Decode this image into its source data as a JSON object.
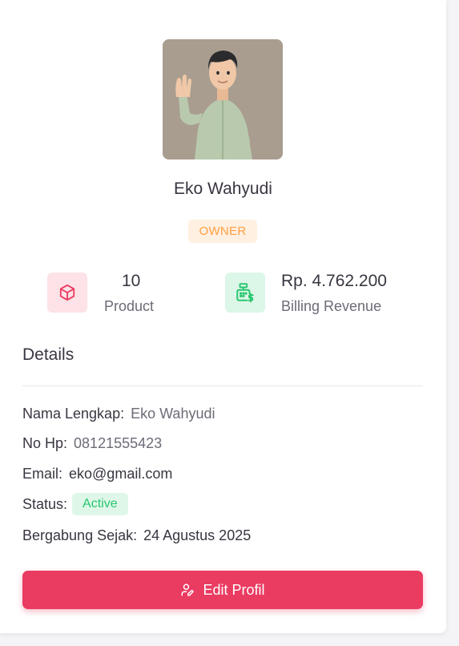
{
  "profile": {
    "name": "Eko Wahyudi",
    "role": "OWNER",
    "avatar_icon": "user-avatar-3d"
  },
  "stats": {
    "product": {
      "value": "10",
      "label": "Product",
      "icon": "cube-icon",
      "color": "#ea3b61"
    },
    "revenue": {
      "value": "Rp. 4.762.200",
      "label": "Billing Revenue",
      "icon": "cash-register-icon",
      "color": "#28c76f"
    }
  },
  "details": {
    "title": "Details",
    "full_name_label": "Nama Lengkap:",
    "full_name": "Eko Wahyudi",
    "phone_label": "No Hp:",
    "phone": "08121555423",
    "email_label": "Email:",
    "email": "eko@gmail.com",
    "status_label": "Status:",
    "status": "Active",
    "joined_label": "Bergabung Sejak:",
    "joined": "24 Agustus 2025"
  },
  "actions": {
    "edit_label": "Edit Profil",
    "edit_icon": "user-edit-icon"
  },
  "colors": {
    "primary": "#ea3b61",
    "warning": "#ff9f43",
    "success": "#28c76f"
  }
}
